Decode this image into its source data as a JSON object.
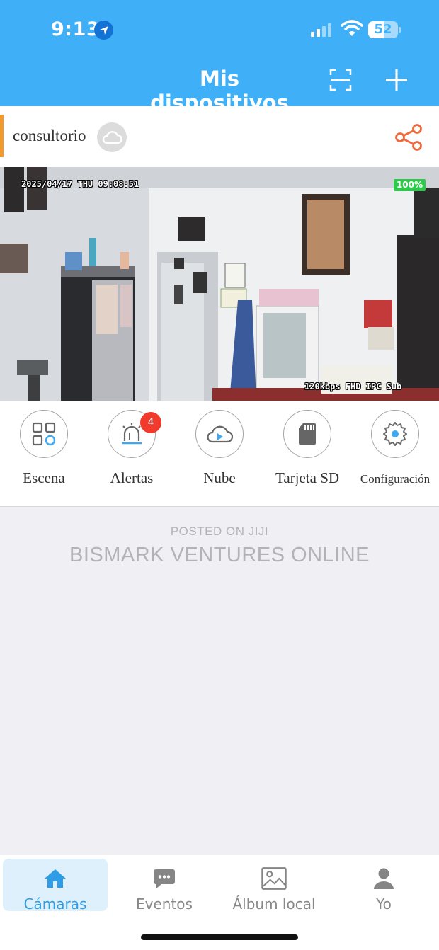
{
  "status_bar": {
    "time": "9:13",
    "battery_level": "52",
    "battery_fraction": 0.52,
    "icons": [
      "location-arrow-icon",
      "cellular-signal-icon",
      "wifi-icon",
      "battery-icon"
    ]
  },
  "header": {
    "title": "Mis dispositivos",
    "icons": [
      "scan-icon",
      "plus-icon"
    ]
  },
  "device": {
    "name": "consultorio",
    "status_icon": "cloud-offline-icon",
    "share_icon": "share-icon",
    "feed": {
      "timestamp": "2025/04/17 THU 09:08:51",
      "battery": "100%",
      "stream_info": "120kbps FHD IPC Sub"
    }
  },
  "actions": [
    {
      "label": "Escena",
      "icon": "scene-grid-icon"
    },
    {
      "label": "Alertas",
      "icon": "alarm-icon",
      "badge": "4"
    },
    {
      "label": "Nube",
      "icon": "cloud-play-icon"
    },
    {
      "label": "Tarjeta SD",
      "icon": "sd-card-icon"
    },
    {
      "label": "Configuración",
      "icon": "gear-icon"
    }
  ],
  "watermark": {
    "line1": "POSTED ON JIJI",
    "line2": "BISMARK VENTURES ONLINE"
  },
  "bottom_nav": [
    {
      "label": "Cámaras",
      "icon": "home-icon",
      "active": true
    },
    {
      "label": "Eventos",
      "icon": "chat-bubble-icon",
      "active": false
    },
    {
      "label": "Álbum local",
      "icon": "image-icon",
      "active": false
    },
    {
      "label": "Yo",
      "icon": "person-icon",
      "active": false
    }
  ],
  "colors": {
    "brand": "#3fb0f7",
    "accent": "#f39a2e",
    "badge": "#f23a2c",
    "active_nav": "#2f9de6"
  }
}
